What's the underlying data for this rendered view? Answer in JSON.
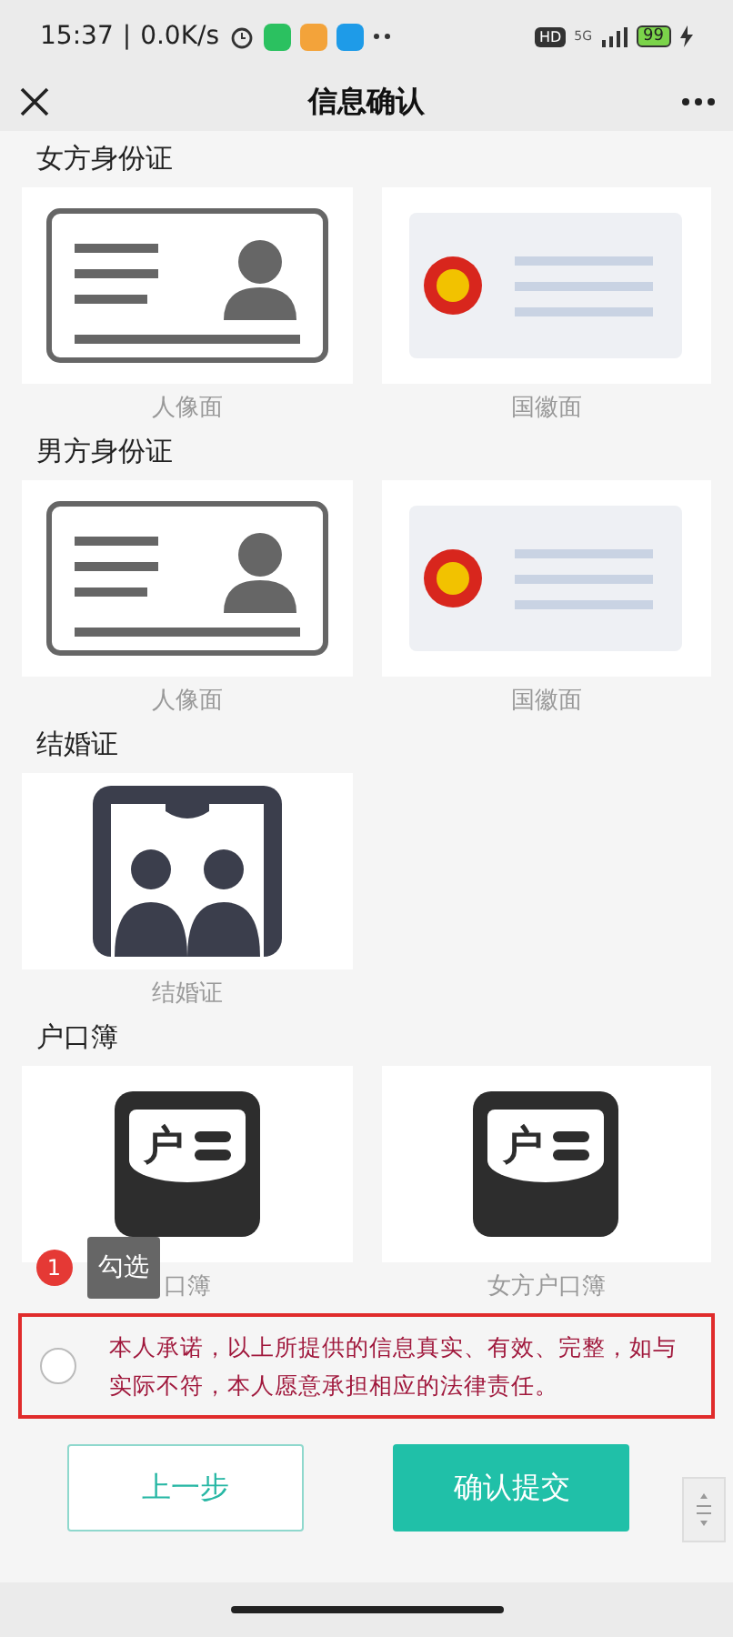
{
  "status_bar": {
    "time": "15:37",
    "separator": "|",
    "speed": "0.0K/s",
    "hd": "HD",
    "network": "5G",
    "battery": "99"
  },
  "nav": {
    "title": "信息确认"
  },
  "sections": [
    {
      "title": "女方身份证",
      "cards": [
        {
          "kind": "id_portrait",
          "label": "人像面"
        },
        {
          "kind": "id_emblem",
          "label": "国徽面"
        }
      ]
    },
    {
      "title": "男方身份证",
      "cards": [
        {
          "kind": "id_portrait",
          "label": "人像面"
        },
        {
          "kind": "id_emblem",
          "label": "国徽面"
        }
      ]
    },
    {
      "title": "结婚证",
      "cards": [
        {
          "kind": "marriage",
          "label": "结婚证"
        }
      ]
    },
    {
      "title": "户口簿",
      "cards": [
        {
          "kind": "household",
          "label": "口簿",
          "icon_char": "户"
        },
        {
          "kind": "household",
          "label": "女方户口簿",
          "icon_char": "户"
        }
      ]
    }
  ],
  "tooltip": {
    "badge": "1",
    "text": "勾选"
  },
  "agreement": {
    "checked": false,
    "text": "本人承诺，以上所提供的信息真实、有效、完整，如与实际不符，本人愿意承担相应的法律责任。"
  },
  "buttons": [
    {
      "kind": "secondary",
      "label": "上一步"
    },
    {
      "kind": "primary",
      "label": "确认提交"
    }
  ]
}
